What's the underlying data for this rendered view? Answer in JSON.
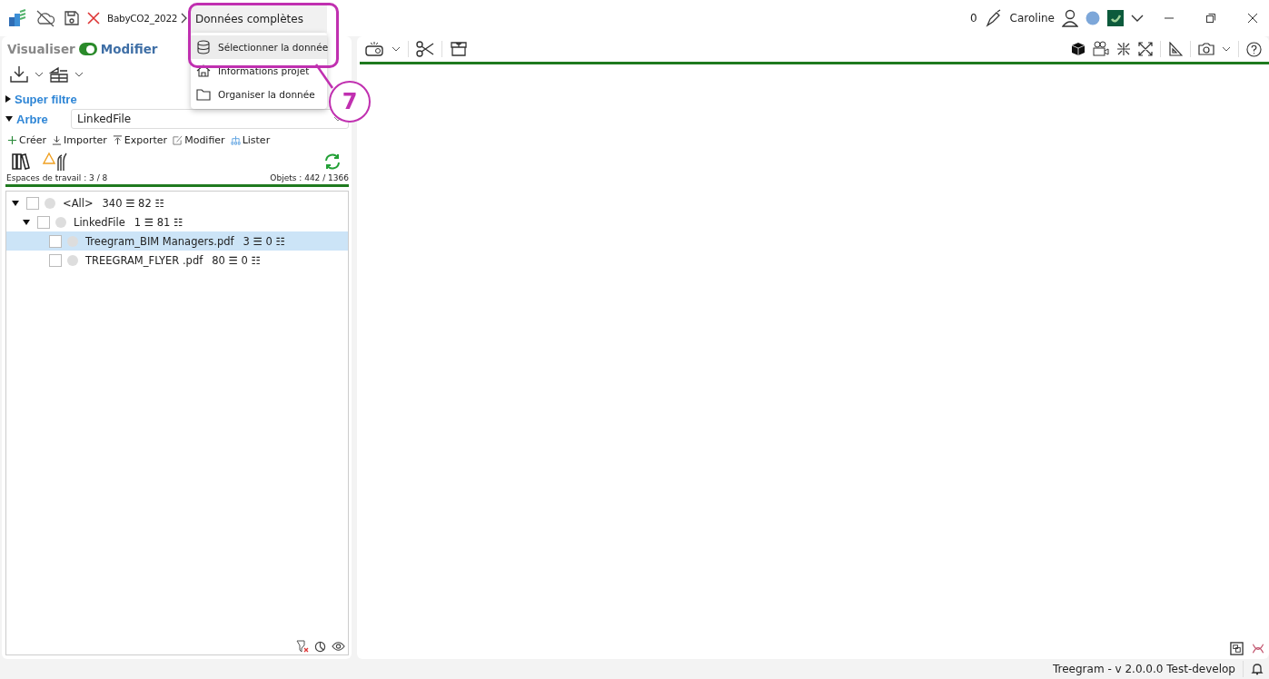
{
  "titlebar": {
    "project": "BabyCO2_2022",
    "count": "0",
    "user": "Caroline"
  },
  "menu": {
    "title": "Données complètes",
    "items": [
      {
        "label": "Sélectionner la donnée",
        "selected": true
      },
      {
        "label": "Informations projet",
        "selected": false
      },
      {
        "label": "Organiser la donnée",
        "selected": false
      }
    ]
  },
  "annotation": {
    "label": "7"
  },
  "mode": {
    "left": "Visualiser",
    "right": "Modifier",
    "on": true
  },
  "sections": [
    {
      "label": "Super filtre",
      "expanded": false
    },
    {
      "label": "Arbre",
      "expanded": true
    }
  ],
  "tree_select": {
    "value": "LinkedFile"
  },
  "actions": [
    "Créer",
    "Importer",
    "Exporter",
    "Modifier",
    "Lister"
  ],
  "workspaces": "Espaces de travail : 3 / 8",
  "objects": "Objets : 442 / 1366",
  "tree": [
    {
      "label": "<All>",
      "counts": "340 ☰ 82 ☷",
      "checked": false,
      "selected": false,
      "expanded": true,
      "children": [
        {
          "label": "LinkedFile",
          "counts": "1 ☰ 81 ☷",
          "checked": false,
          "selected": false,
          "expanded": true,
          "children": [
            {
              "label": "Treegram_BIM Managers.pdf",
              "counts": "3 ☰ 0 ☷",
              "checked": false,
              "selected": true
            },
            {
              "label": "TREEGRAM_FLYER .pdf",
              "counts": "80 ☰ 0 ☷",
              "checked": false,
              "selected": false
            }
          ]
        }
      ]
    }
  ],
  "status_bar": {
    "version": "Treegram - v 2.0.0.0 Test-develop"
  }
}
